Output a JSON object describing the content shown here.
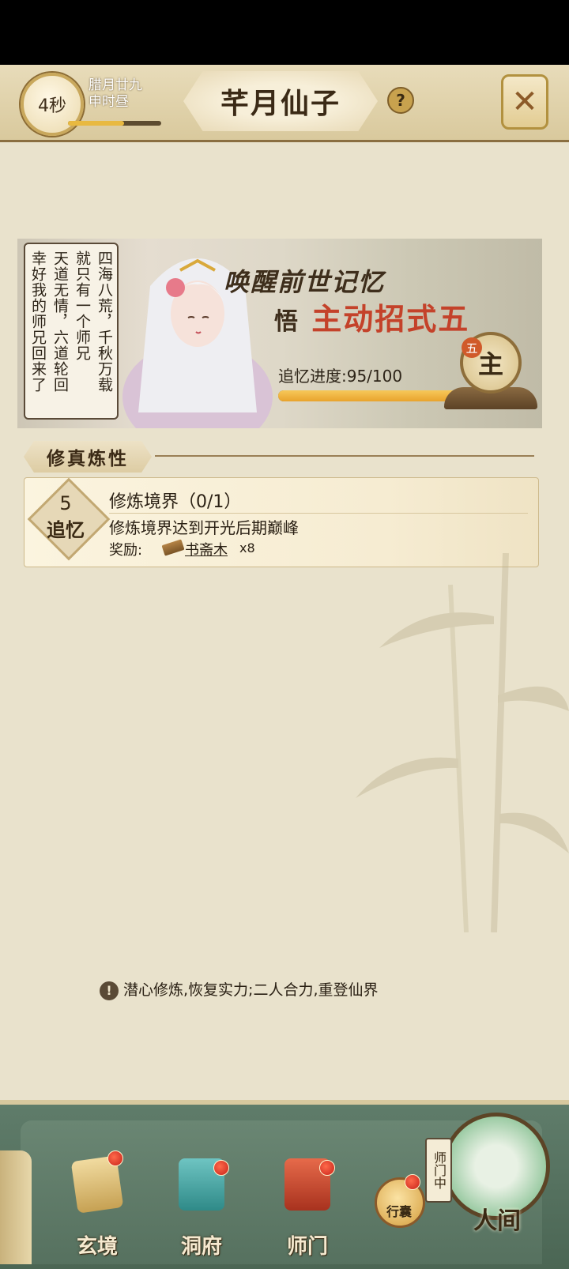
{
  "header": {
    "timer": "4秒",
    "date_line1": "腊月廿九",
    "date_line2": "申时昼",
    "date_progress": 0.6,
    "title": "芊月仙子",
    "help": "?",
    "close": "✕"
  },
  "banner": {
    "speech_columns": [
      "四海八荒，千秋万载",
      "就只有一个师兄",
      "天道无情，六道轮回",
      "幸好我的师兄回来了"
    ],
    "headline": "唤醒前世记忆",
    "skill_prefix": "悟",
    "skill_name": "主动招式五",
    "progress_label": "追忆进度:95/100",
    "progress_value": 0.95,
    "seal_char": "主",
    "seal_badge": "五"
  },
  "section": {
    "title": "修真炼性"
  },
  "quest": {
    "number": "5",
    "tag": "追忆",
    "title": "修炼境界（0/1）",
    "description": "修炼境界达到开光后期巅峰",
    "reward_label": "奖励:",
    "reward_item": "书斋木",
    "reward_count": "x8"
  },
  "notice": {
    "icon": "!",
    "text": "潜心修炼,恢复实力;二人合力,重登仙界"
  },
  "nav": {
    "items": [
      {
        "label": "玄境",
        "icon": "scroll-icon"
      },
      {
        "label": "洞府",
        "icon": "lantern-icon"
      },
      {
        "label": "师门",
        "icon": "banner-icon"
      }
    ],
    "bag_label": "行囊",
    "sect_tag": "师门中",
    "world_label": "人间"
  },
  "colors": {
    "accent_gold": "#e8b941",
    "panel_bg": "#e9e2cc",
    "nav_green": "#5f7c6a",
    "alert_red": "#c7221a"
  }
}
